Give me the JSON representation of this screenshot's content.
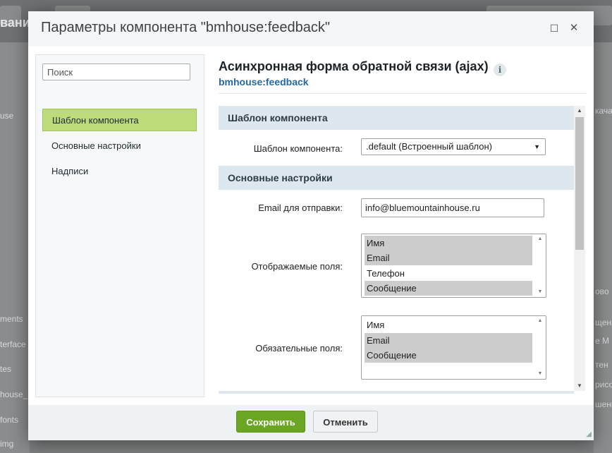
{
  "background": {
    "left_texts": [
      "вани",
      "use",
      "ments",
      "terface",
      "tes",
      "house_",
      "fonts",
      "img"
    ],
    "right_texts": [
      "кача",
      "ово",
      "щени",
      "е М",
      "тен",
      "рисо",
      "шени"
    ]
  },
  "dialog": {
    "title": "Параметры компонента \"bmhouse:feedback\"",
    "maximize_glyph": "☐",
    "close_glyph": "✕"
  },
  "sidebar": {
    "search_placeholder": "Поиск",
    "items": [
      {
        "label": "Шаблон компонента",
        "active": true
      },
      {
        "label": "Основные настройки",
        "active": false
      },
      {
        "label": "Надписи",
        "active": false
      }
    ]
  },
  "main": {
    "title": "Асинхронная форма обратной связи (ajax)",
    "subtitle": "bmhouse:feedback",
    "info_glyph": "i",
    "sections": [
      {
        "title": "Шаблон компонента",
        "fields": [
          {
            "label": "Шаблон компонента:",
            "value": ".default (Встроенный шаблон)",
            "arrow": "▼"
          }
        ]
      },
      {
        "title": "Основные настройки",
        "fields": [
          {
            "label": "Email для отправки:",
            "value": "info@bluemountainhouse.ru"
          },
          {
            "label": "Отображаемые поля:",
            "options": [
              {
                "text": "Имя",
                "selected": true
              },
              {
                "text": "Email",
                "selected": true
              },
              {
                "text": "Телефон",
                "selected": false
              },
              {
                "text": "Сообщение",
                "selected": true
              }
            ]
          },
          {
            "label": "Обязательные поля:",
            "options": [
              {
                "text": "Имя",
                "selected": false
              },
              {
                "text": "Email",
                "selected": true
              },
              {
                "text": "Сообщение",
                "selected": true
              }
            ]
          }
        ]
      }
    ]
  },
  "footer": {
    "save_label": "Сохранить",
    "cancel_label": "Отменить"
  },
  "colors": {
    "accent_green": "#6aa624",
    "active_item": "#bddb79",
    "section_bg": "#dde7ef",
    "link_blue": "#2368a4"
  }
}
